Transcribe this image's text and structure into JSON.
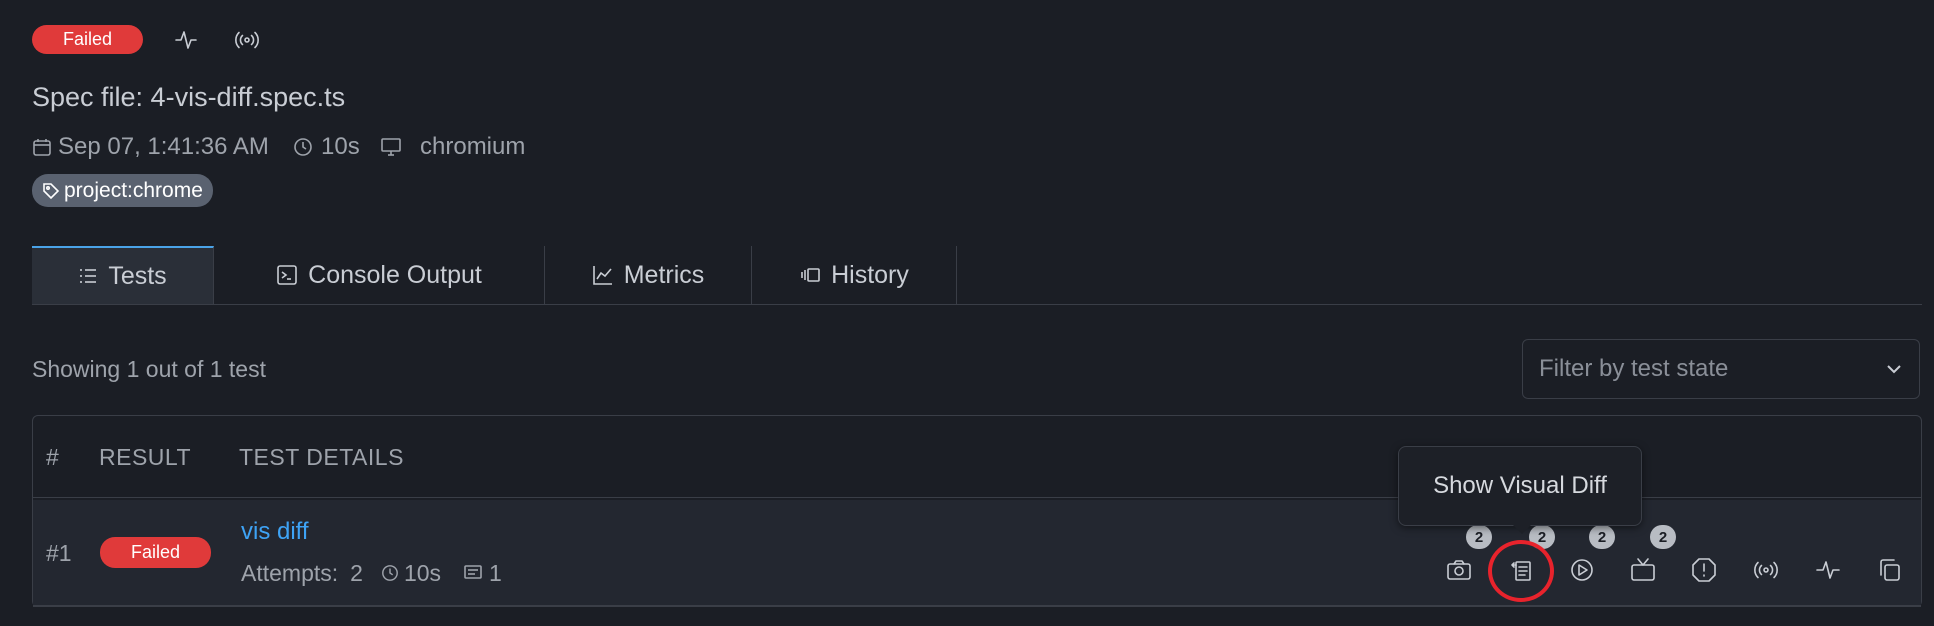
{
  "header": {
    "status": "Failed",
    "icons": [
      "activity-icon",
      "broadcast-icon"
    ]
  },
  "spec": {
    "title": "Spec file: 4-vis-diff.spec.ts",
    "date": "Sep 07, 1:41:36 AM",
    "duration": "10s",
    "browser": "chromium",
    "tag": "project:chrome"
  },
  "tabs": [
    {
      "label": "Tests",
      "icon": "list-icon",
      "active": true
    },
    {
      "label": "Console Output",
      "icon": "terminal-icon",
      "active": false
    },
    {
      "label": "Metrics",
      "icon": "chart-icon",
      "active": false
    },
    {
      "label": "History",
      "icon": "history-icon",
      "active": false
    }
  ],
  "tests": {
    "summary": "Showing 1 out of 1 test",
    "filter": {
      "placeholder": "Filter by test state"
    },
    "columns": [
      "#",
      "RESULT",
      "TEST DETAILS"
    ],
    "rows": [
      {
        "index": "#1",
        "result": "Failed",
        "name": "vis diff",
        "attempts_label": "Attempts:",
        "attempts": "2",
        "duration": "10s",
        "errors": "1",
        "actions": [
          {
            "icon": "camera-icon",
            "count": "2"
          },
          {
            "icon": "visual-diff-icon",
            "count": "2"
          },
          {
            "icon": "play-icon",
            "count": "2"
          },
          {
            "icon": "tv-icon",
            "count": "2"
          },
          {
            "icon": "alert-icon",
            "count": ""
          },
          {
            "icon": "broadcast-icon",
            "count": ""
          },
          {
            "icon": "activity-icon",
            "count": ""
          },
          {
            "icon": "copy-icon",
            "count": ""
          }
        ]
      }
    ]
  },
  "tooltip": {
    "text": "Show Visual Diff"
  },
  "colors": {
    "background": "#1b1e25",
    "failed": "#e03a3a",
    "link": "#3ea3f5",
    "highlight": "#e8232c"
  }
}
